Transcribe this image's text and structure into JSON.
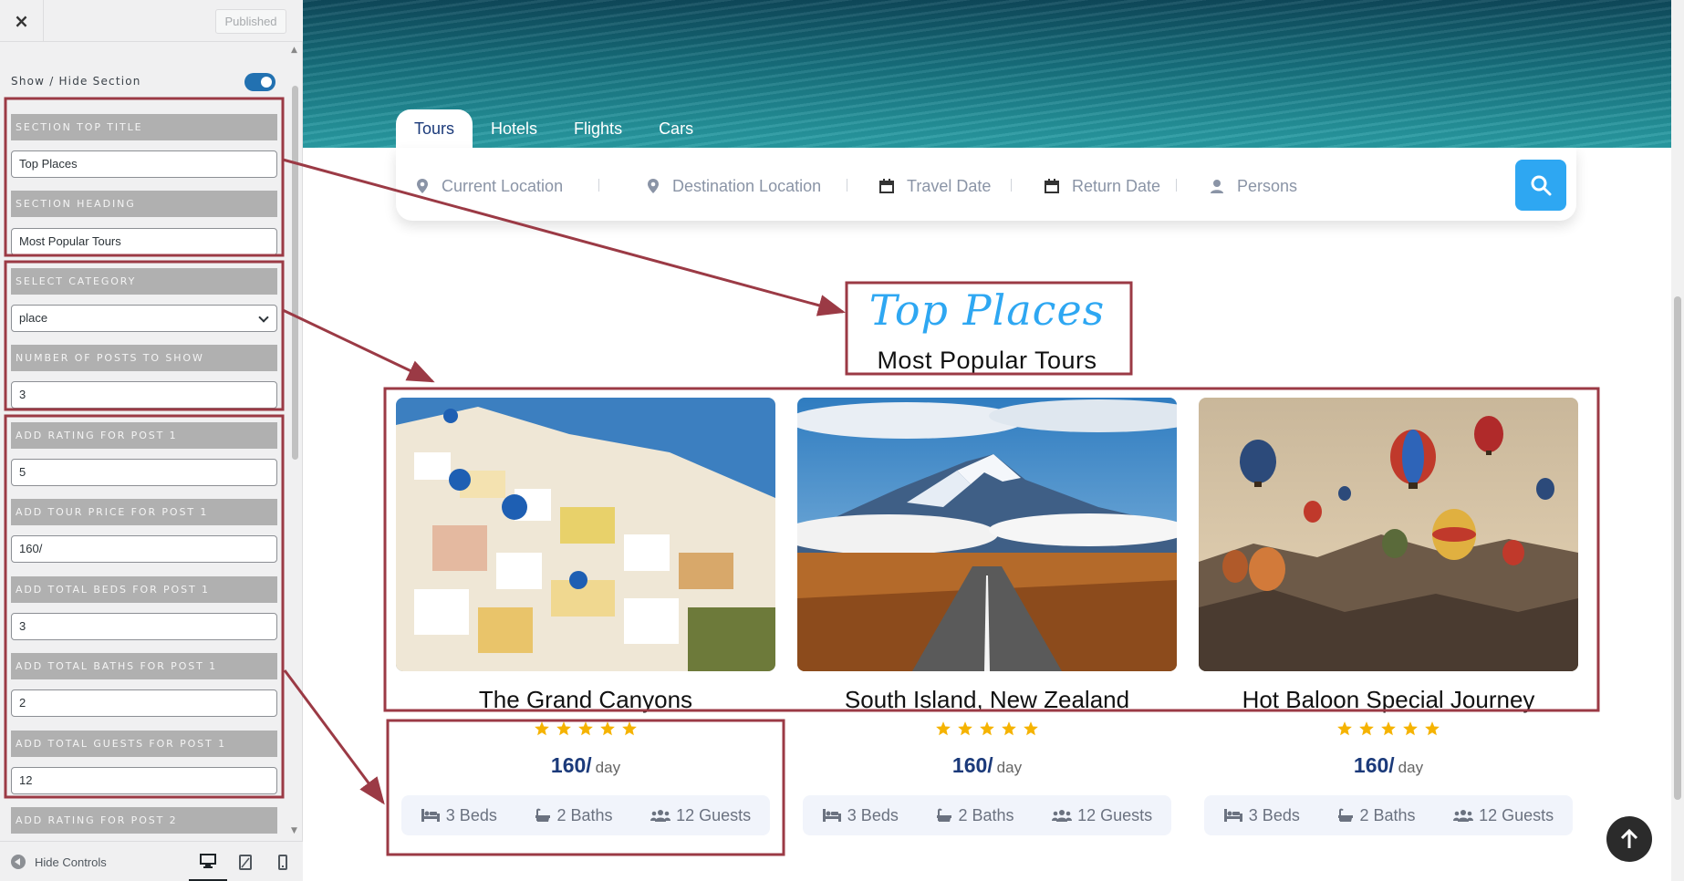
{
  "panel": {
    "close_label": "×",
    "publish_label": "Published",
    "toggle_label": "Show / Hide Section",
    "fields": {
      "section_top_title": {
        "label": "SECTION TOP TITLE",
        "value": "Top Places"
      },
      "section_heading": {
        "label": "SECTION HEADING",
        "value": "Most Popular Tours"
      },
      "select_category": {
        "label": "SELECT CATEGORY",
        "value": "place"
      },
      "posts_to_show": {
        "label": "NUMBER OF POSTS TO SHOW",
        "value": "3"
      },
      "rating_1": {
        "label": "ADD RATING FOR POST 1",
        "value": "5"
      },
      "price_1": {
        "label": "ADD TOUR PRICE FOR POST 1",
        "value": "160/"
      },
      "beds_1": {
        "label": "ADD TOTAL BEDS FOR POST 1",
        "value": "3"
      },
      "baths_1": {
        "label": "ADD TOTAL BATHS FOR POST 1",
        "value": "2"
      },
      "guests_1": {
        "label": "ADD TOTAL GUESTS FOR POST 1",
        "value": "12"
      },
      "rating_2": {
        "label": "ADD RATING FOR POST 2"
      }
    },
    "footer": {
      "hide_controls": "Hide Controls"
    }
  },
  "preview": {
    "tabs": [
      "Tours",
      "Hotels",
      "Flights",
      "Cars"
    ],
    "search": {
      "current_location": "Current Location",
      "destination_location": "Destination Location",
      "travel_date": "Travel Date",
      "return_date": "Return Date",
      "persons": "Persons"
    },
    "section_top_title": "Top Places",
    "section_heading": "Most Popular Tours",
    "cards": [
      {
        "title": "The Grand Canyons",
        "rating": 5,
        "price": "160/",
        "unit": "day",
        "beds": "3 Beds",
        "baths": "2 Baths",
        "guests": "12 Guests"
      },
      {
        "title": "South Island, New Zealand",
        "rating": 5,
        "price": "160/",
        "unit": "day",
        "beds": "3 Beds",
        "baths": "2 Baths",
        "guests": "12 Guests"
      },
      {
        "title": "Hot Baloon Special Journey",
        "rating": 5,
        "price": "160/",
        "unit": "day",
        "beds": "3 Beds",
        "baths": "2 Baths",
        "guests": "12 Guests"
      }
    ]
  },
  "colors": {
    "accent": "#2ea7f2",
    "brand_dark": "#1b3a7a",
    "star": "#f5b301",
    "annotation": "#9b3a45",
    "wp_blue": "#2271b1"
  }
}
